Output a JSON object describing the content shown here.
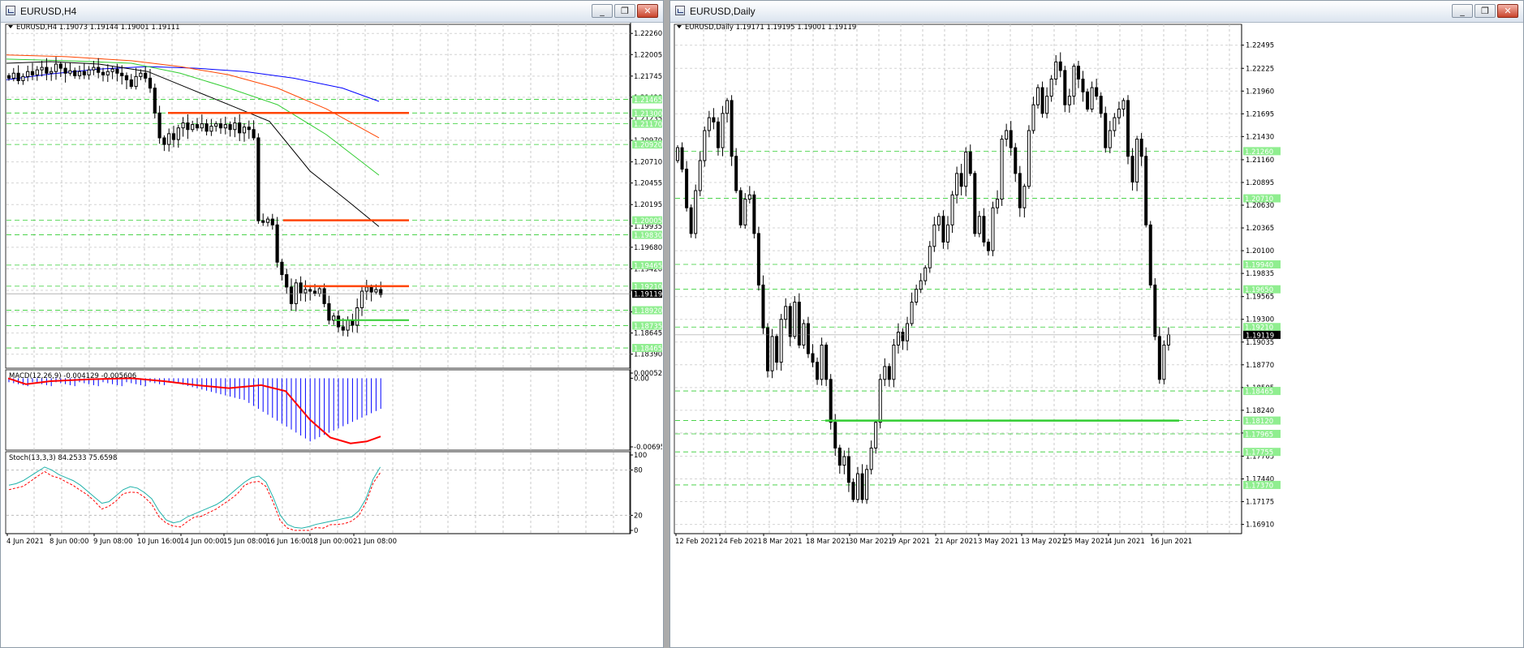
{
  "left_window": {
    "title": "EURUSD,H4",
    "minimize_label": "_",
    "restore_label": "❐",
    "close_label": "✕",
    "info_line": "EURUSD,H4  1.19073 1.19144 1.19001 1.19111",
    "macd_label": "MACD(12,26,9) -0.004129 -0.005606",
    "stoch_label": "Stoch(13,3,3) 84.2533 75.6598"
  },
  "right_window": {
    "title": "EURUSD,Daily",
    "minimize_label": "_",
    "restore_label": "❐",
    "close_label": "✕",
    "info_line": "EURUSD,Daily  1.19171 1.19195 1.19001 1.19119"
  },
  "colors": {
    "resistance": "#ff4500",
    "support": "#32cd32",
    "level_label_bg": "#90ee90",
    "ma_blue": "#0000ff",
    "ma_red": "#ff4500",
    "ma_green": "#32cd32",
    "ma_black": "#000000",
    "macd_hist": "#0000ff",
    "macd_signal": "#ff0000",
    "stoch_main": "#20b2aa",
    "stoch_signal": "#ff0000"
  },
  "chart_data": [
    {
      "id": "h4-price",
      "type": "candlestick",
      "symbol": "EURUSD",
      "timeframe": "H4",
      "ylim": [
        1.1826,
        1.2235
      ],
      "yticks": [
        "1.22260",
        "1.22005",
        "1.21745",
        "1.21490",
        "1.21235",
        "1.20970",
        "1.20710",
        "1.20455",
        "1.20195",
        "1.19935",
        "1.19680",
        "1.19420",
        "1.19160",
        "1.18900",
        "1.18645",
        "1.18390"
      ],
      "price_levels": [
        {
          "value": 1.21465,
          "label": "1.21465"
        },
        {
          "value": 1.213,
          "label": "1.21300"
        },
        {
          "value": 1.2117,
          "label": "1.21170"
        },
        {
          "value": 1.2092,
          "label": "1.20920"
        },
        {
          "value": 1.20005,
          "label": "1.20005"
        },
        {
          "value": 1.1983,
          "label": "1.19830"
        },
        {
          "value": 1.19465,
          "label": "1.19465"
        },
        {
          "value": 1.1921,
          "label": "1.19210"
        },
        {
          "value": 1.1892,
          "label": "1.18920"
        },
        {
          "value": 1.18735,
          "label": "1.18735"
        },
        {
          "value": 1.18465,
          "label": "1.18465"
        }
      ],
      "current_price": {
        "value": 1.19119,
        "label": "1.19119"
      },
      "xticks": [
        "4 Jun 2021",
        "8 Jun 00:00",
        "9 Jun 08:00",
        "10 Jun 16:00",
        "14 Jun 00:00",
        "15 Jun 08:00",
        "16 Jun 16:00",
        "18 Jun 00:00",
        "21 Jun 08:00"
      ],
      "resistance_lines": [
        1.213,
        1.20005,
        1.1921
      ],
      "support_lines": [
        1.188
      ]
    },
    {
      "id": "h4-macd",
      "type": "bar",
      "title": "MACD(12,26,9)",
      "ylim": [
        -0.006952,
        0.000526
      ],
      "yticks": [
        "0.000526",
        "0.00",
        "-0.006952"
      ]
    },
    {
      "id": "h4-stoch",
      "type": "line",
      "title": "Stoch(13,3,3)",
      "ylim": [
        0,
        100
      ],
      "yticks": [
        "100",
        "80",
        "20",
        "0"
      ]
    },
    {
      "id": "daily-price",
      "type": "candlestick",
      "symbol": "EURUSD",
      "timeframe": "Daily",
      "ylim": [
        1.1684,
        1.227
      ],
      "yticks": [
        "1.22495",
        "1.22225",
        "1.21960",
        "1.21695",
        "1.21430",
        "1.21160",
        "1.20895",
        "1.20630",
        "1.20365",
        "1.20100",
        "1.19835",
        "1.19565",
        "1.19300",
        "1.19035",
        "1.18770",
        "1.18505",
        "1.18240",
        "1.17975",
        "1.17705",
        "1.17440",
        "1.17175",
        "1.16910"
      ],
      "price_levels": [
        {
          "value": 1.2126,
          "label": "1.21260"
        },
        {
          "value": 1.2071,
          "label": "1.20710"
        },
        {
          "value": 1.1994,
          "label": "1.19940"
        },
        {
          "value": 1.1965,
          "label": "1.19650"
        },
        {
          "value": 1.1921,
          "label": "1.19210"
        },
        {
          "value": 1.18465,
          "label": "1.18465"
        },
        {
          "value": 1.1812,
          "label": "1.18120"
        },
        {
          "value": 1.17965,
          "label": "1.17965"
        },
        {
          "value": 1.17755,
          "label": "1.17755"
        },
        {
          "value": 1.1737,
          "label": "1.17370"
        }
      ],
      "current_price": {
        "value": 1.19119,
        "label": "1.19119"
      },
      "xticks": [
        "12 Feb 2021",
        "24 Feb 2021",
        "8 Mar 2021",
        "18 Mar 2021",
        "30 Mar 2021",
        "9 Apr 2021",
        "21 Apr 2021",
        "3 May 2021",
        "13 May 2021",
        "25 May 2021",
        "4 Jun 2021",
        "16 Jun 2021"
      ],
      "support_lines": [
        1.1812
      ]
    }
  ]
}
